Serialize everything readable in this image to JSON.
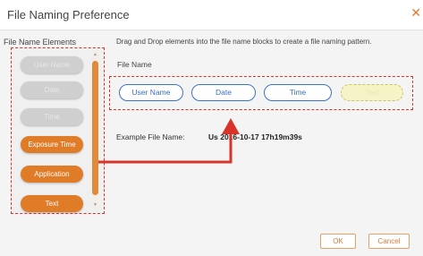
{
  "dialog": {
    "title": "File Naming Preference",
    "close_glyph": "✕"
  },
  "elements_panel": {
    "label": "File Name Elements",
    "items": [
      {
        "label": "User Name",
        "state": "disabled"
      },
      {
        "label": "Date",
        "state": "disabled"
      },
      {
        "label": "Time",
        "state": "disabled"
      },
      {
        "label": "Exposure Time",
        "state": "active"
      },
      {
        "label": "Application",
        "state": "active"
      },
      {
        "label": "Text",
        "state": "active"
      }
    ]
  },
  "main": {
    "instruction": "Drag and Drop elements into the file name blocks to create a file naming pattern.",
    "file_name_label": "File Name",
    "blocks": [
      {
        "label": "User Name"
      },
      {
        "label": "Date"
      },
      {
        "label": "Time"
      },
      {
        "label": "Text"
      }
    ],
    "example_label": "Example File Name:",
    "example_value": "Us  2016-10-17 17h19m39s"
  },
  "buttons": {
    "ok": "OK",
    "cancel": "Cancel"
  },
  "colors": {
    "accent": "#e07b28",
    "annotation": "#d9342b",
    "block_border": "#3a73c8"
  }
}
